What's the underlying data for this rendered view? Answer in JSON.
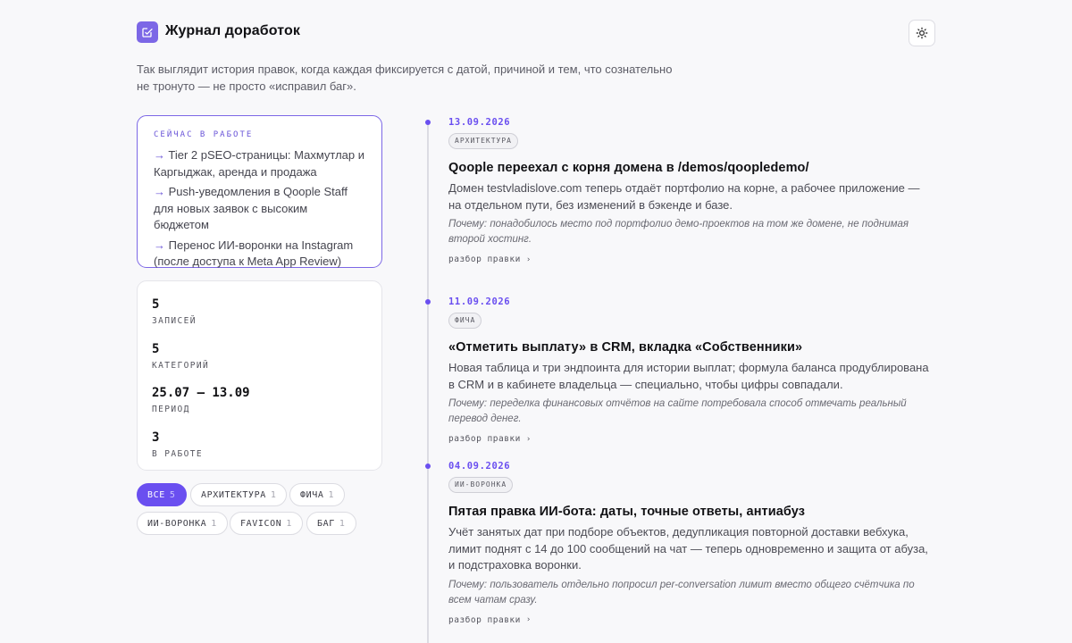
{
  "header": {
    "title": "Журнал доработок",
    "logo_icon": "edit-square-icon",
    "theme_icon": "sun-icon",
    "accent": "#7c67e6"
  },
  "intro": "Так выглядит история правок, когда каждая фиксируется с датой, причиной и тем, что сознательно не тронуто — не просто «исправил баг».",
  "now": {
    "title": "СЕЙЧАС В РАБОТЕ",
    "items": [
      {
        "arrow": "→",
        "text": "Tier 2 pSEO-страницы: Махмутлар и Каргыджак, аренда и продажа"
      },
      {
        "arrow": "→",
        "text": "Push-уведомления в Qoople Staff для новых заявок с высоким бюджетом"
      },
      {
        "arrow": "→",
        "text": "Перенос ИИ-воронки на Instagram (после доступа к Meta App Review)"
      }
    ]
  },
  "stats": [
    {
      "value": "5",
      "label": "ЗАПИСЕЙ"
    },
    {
      "value": "5",
      "label": "КАТЕГОРИЙ"
    },
    {
      "value": "25.07 — 13.09",
      "label": "ПЕРИОД"
    },
    {
      "value": "3",
      "label": "В РАБОТЕ"
    }
  ],
  "filters": [
    {
      "label": "ВСЕ",
      "count": "5"
    },
    {
      "label": "АРХИТЕКТУРА",
      "count": "1"
    },
    {
      "label": "ФИЧА",
      "count": "1"
    },
    {
      "label": "ИИ-ВОРОНКА",
      "count": "1"
    },
    {
      "label": "FAVICON",
      "count": "1"
    },
    {
      "label": "БАГ",
      "count": "1"
    }
  ],
  "entries": [
    {
      "date": "13.09.2026",
      "tag": "АРХИТЕКТУРА",
      "title": "Qoople переехал с корня домена в /demos/qoopledemo/",
      "desc": "Домен testvladislove.com теперь отдаёт портфолио на корне, а рабочее приложение — на отдельном пути, без изменений в бэкенде и базе.",
      "why": "Почему: понадобилось место под портфолио демо-проектов на том же домене, не поднимая второй хостинг.",
      "more": "разбор правки",
      "chevron": "›"
    },
    {
      "date": "11.09.2026",
      "tag": "ФИЧА",
      "title": "«Отметить выплату» в CRM, вкладка «Собственники»",
      "desc": "Новая таблица и три эндпоинта для истории выплат; формула баланса продублирована в CRM и в кабинете владельца — специально, чтобы цифры совпадали.",
      "why": "Почему: переделка финансовых отчётов на сайте потребовала способ отмечать реальный перевод денег.",
      "more": "разбор правки",
      "chevron": "›"
    },
    {
      "date": "04.09.2026",
      "tag": "ИИ-ВОРОНКА",
      "title": "Пятая правка ИИ-бота: даты, точные ответы, антиабуз",
      "desc": "Учёт занятых дат при подборе объектов, дедупликация повторной доставки вебхука, лимит поднят с 14 до 100 сообщений на чат — теперь одновременно и защита от абуза, и подстраховка воронки.",
      "why": "Почему: пользователь отдельно попросил per-conversation лимит вместо общего счётчика по всем чатам сразу.",
      "more": "разбор правки",
      "chevron": "›"
    }
  ]
}
